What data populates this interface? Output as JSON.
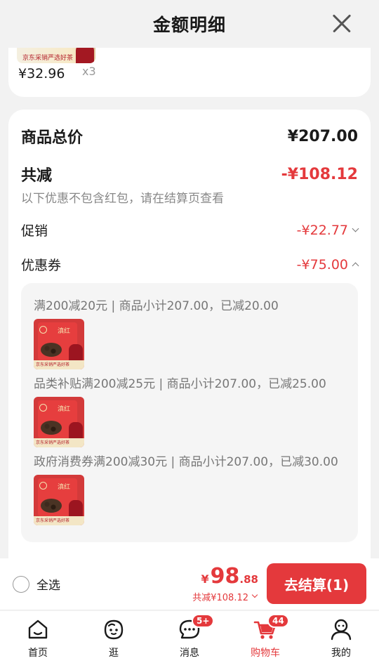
{
  "header": {
    "title": "金额明细"
  },
  "top_item": {
    "price": "¥32.96",
    "qty": "x3",
    "thumb_text": "京东采销严选好茶"
  },
  "summary": {
    "total_label": "商品总价",
    "total_value": "¥207.00",
    "discount_label": "共减",
    "discount_value": "-¥108.12",
    "note": "以下优惠不包含红包，请在结算页查看",
    "promo_label": "促销",
    "promo_value": "-¥22.77",
    "coupon_label": "优惠券",
    "coupon_value": "-¥75.00"
  },
  "coupons": [
    {
      "title": "满200减20元 | 商品小计207.00，已减20.00"
    },
    {
      "title": "品类补贴满200减25元 | 商品小计207.00，已减25.00"
    },
    {
      "title": "政府消费券满200减30元 | 商品小计207.00，已减30.00"
    }
  ],
  "product_thumb": {
    "strip_text": "京东采销严选好茶",
    "brand_text": "滇红"
  },
  "checkout": {
    "select_all": "全选",
    "currency": "¥",
    "price_int": "98",
    "price_dec": ".88",
    "saved": "共减¥108.12",
    "button": "去结算(1)"
  },
  "tabs": [
    {
      "label": "首页",
      "icon": "home-icon"
    },
    {
      "label": "逛",
      "icon": "browse-face-icon"
    },
    {
      "label": "消息",
      "icon": "message-icon",
      "badge": "5+"
    },
    {
      "label": "购物车",
      "icon": "cart-icon",
      "badge": "44"
    },
    {
      "label": "我的",
      "icon": "profile-icon"
    }
  ],
  "colors": {
    "accent": "#e4393c",
    "background": "#f2f2f2"
  }
}
